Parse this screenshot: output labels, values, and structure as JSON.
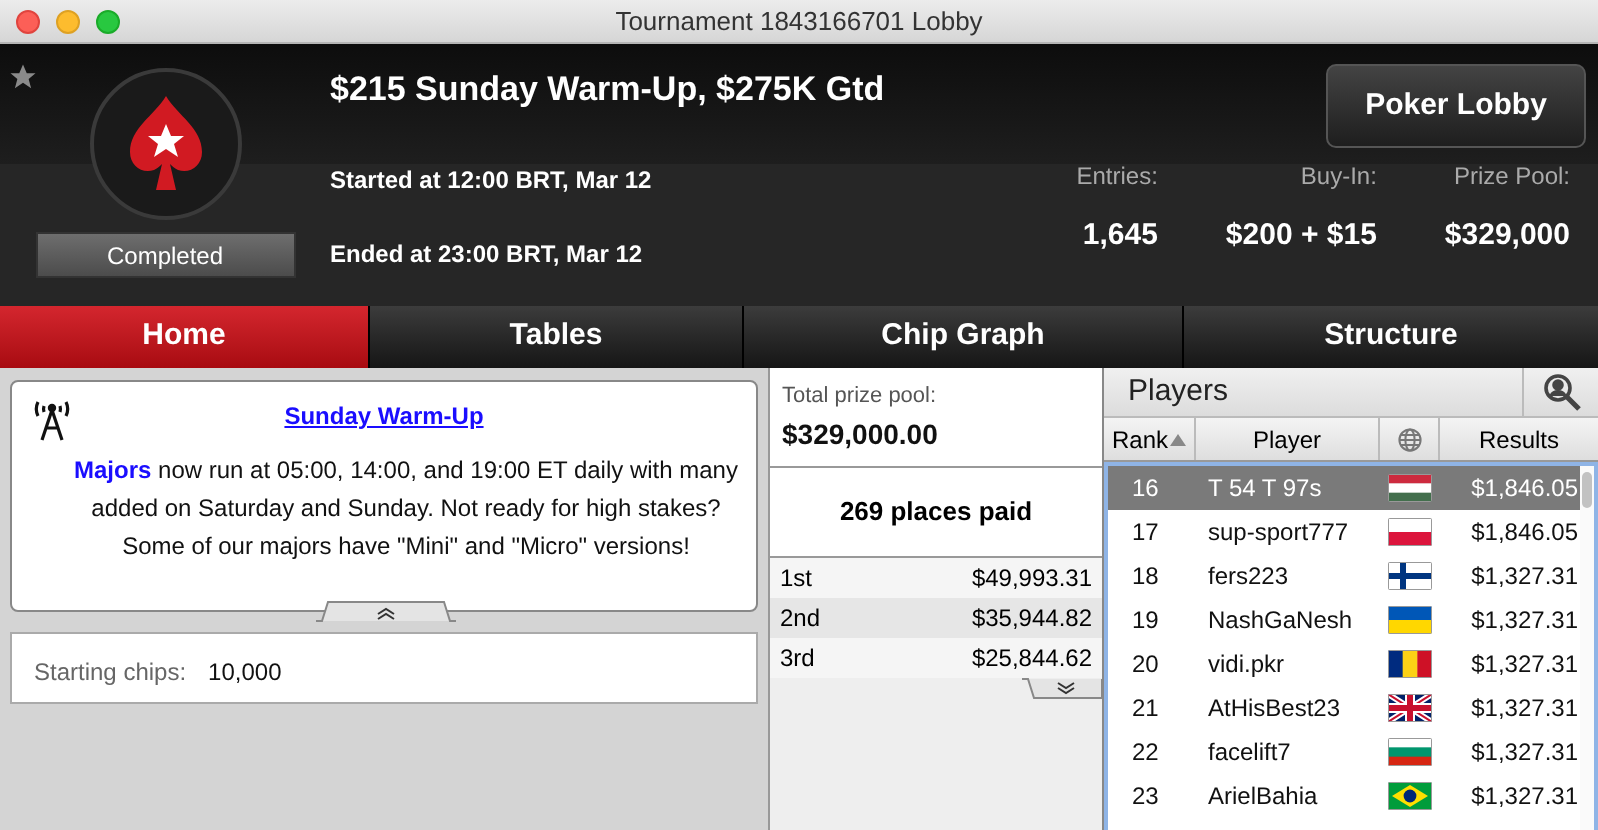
{
  "window": {
    "title": "Tournament 1843166701 Lobby"
  },
  "header": {
    "title": "$215 Sunday Warm-Up, $275K Gtd",
    "status": "Completed",
    "started": "Started at 12:00 BRT, Mar 12",
    "ended": "Ended at 23:00 BRT, Mar 12",
    "lobby_button": "Poker Lobby",
    "stats": [
      {
        "label": "Entries:",
        "value": "1,645"
      },
      {
        "label": "Buy-In:",
        "value": "$200 + $15"
      },
      {
        "label": "Prize Pool:",
        "value": "$329,000"
      }
    ]
  },
  "tabs": [
    {
      "label": "Home",
      "selected": true
    },
    {
      "label": "Tables",
      "selected": false
    },
    {
      "label": "Chip Graph",
      "selected": false
    },
    {
      "label": "Structure",
      "selected": false
    }
  ],
  "news": {
    "link": "Sunday Warm-Up",
    "text": "**Majors** now run at 05:00, 14:00, and 19:00 ET daily with many added on Saturday and Sunday. Not ready for high stakes? Some of our majors have \"Mini\" and \"Micro\" versions!"
  },
  "starting_chips": {
    "label": "Starting chips:",
    "value": "10,000"
  },
  "prizes": {
    "label": "Total prize pool:",
    "total": "$329,000.00",
    "places": "269 places paid",
    "rows": [
      {
        "place": "1st",
        "amount": "$49,993.31"
      },
      {
        "place": "2nd",
        "amount": "$35,944.82"
      },
      {
        "place": "3rd",
        "amount": "$25,844.62"
      }
    ]
  },
  "players": {
    "title": "Players",
    "columns": [
      "Rank",
      "Player",
      "Results"
    ],
    "rows": [
      {
        "rank": "16",
        "name": "T 54 T 97s",
        "result": "$1,846.05",
        "selected": true
      },
      {
        "rank": "17",
        "name": "sup-sport777",
        "result": "$1,846.05",
        "selected": false
      },
      {
        "rank": "18",
        "name": "fers223",
        "result": "$1,327.31",
        "selected": false
      },
      {
        "rank": "19",
        "name": "NashGaNesh",
        "result": "$1,327.31",
        "selected": false
      },
      {
        "rank": "20",
        "name": "vidi.pkr",
        "result": "$1,327.31",
        "selected": false
      },
      {
        "rank": "21",
        "name": "AtHisBest23",
        "result": "$1,327.31",
        "selected": false
      },
      {
        "rank": "22",
        "name": "facelift7",
        "result": "$1,327.31",
        "selected": false
      },
      {
        "rank": "23",
        "name": "ArielBahia",
        "result": "$1,327.31",
        "selected": false
      }
    ]
  }
}
